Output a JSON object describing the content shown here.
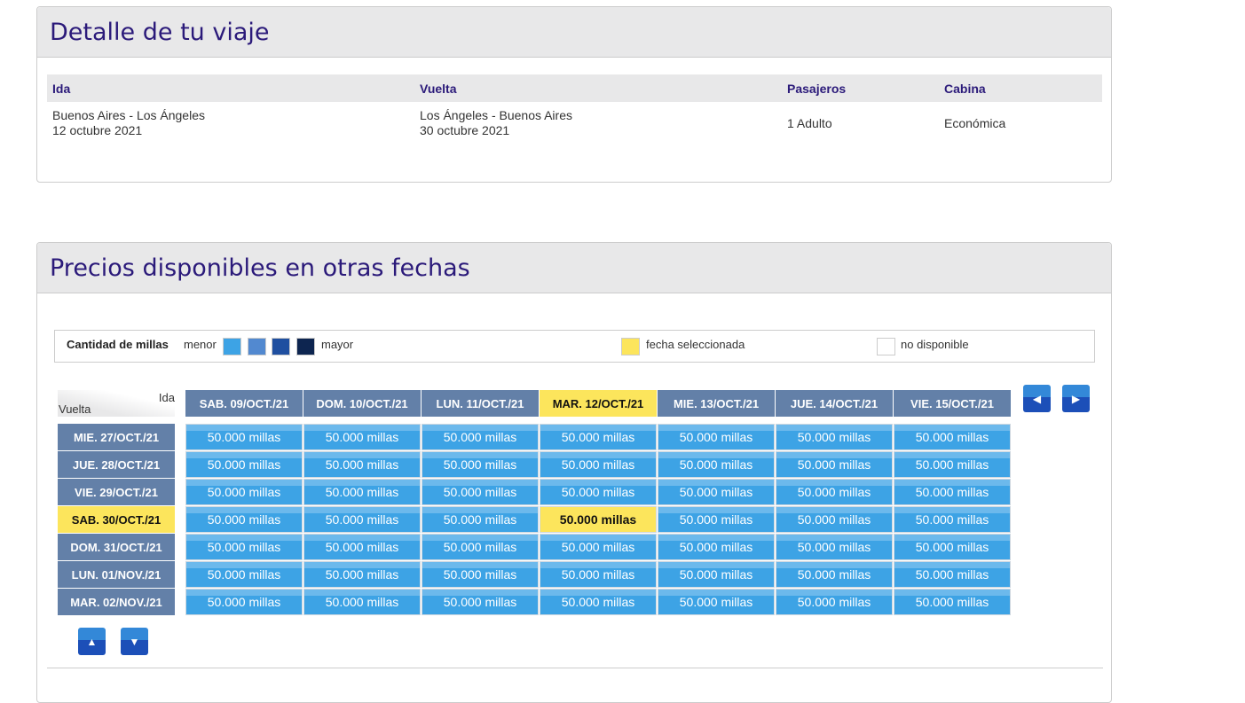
{
  "trip": {
    "title": "Detalle de tu viaje",
    "headers": {
      "ida": "Ida",
      "vuelta": "Vuelta",
      "pasajeros": "Pasajeros",
      "cabina": "Cabina"
    },
    "ida_route": "Buenos Aires - Los Ángeles",
    "ida_date": "12 octubre 2021",
    "vuelta_route": "Los Ángeles - Buenos Aires",
    "vuelta_date": "30 octubre 2021",
    "pasajeros": "1 Adulto",
    "cabina": "Económica"
  },
  "prices": {
    "title": "Precios disponibles en otras fechas",
    "legend": {
      "label": "Cantidad de millas",
      "menor": "menor",
      "mayor": "mayor",
      "selected": "fecha seleccionada",
      "unavailable": "no disponible",
      "colors": [
        "#3da3e5",
        "#5289d0",
        "#1f4fa0",
        "#0d2550"
      ],
      "selected_color": "#fce55c"
    },
    "corner": {
      "ida": "Ida",
      "vuelta": "Vuelta"
    },
    "columns": [
      "SAB. 09/OCT./21",
      "DOM. 10/OCT./21",
      "LUN. 11/OCT./21",
      "MAR. 12/OCT./21",
      "MIE. 13/OCT./21",
      "JUE. 14/OCT./21",
      "VIE. 15/OCT./21"
    ],
    "rows": [
      "MIE. 27/OCT./21",
      "JUE. 28/OCT./21",
      "VIE. 29/OCT./21",
      "SAB. 30/OCT./21",
      "DOM. 31/OCT./21",
      "LUN. 01/NOV./21",
      "MAR. 02/NOV./21"
    ],
    "selected_col": 3,
    "selected_row": 3,
    "cell_value": "50.000 millas"
  }
}
